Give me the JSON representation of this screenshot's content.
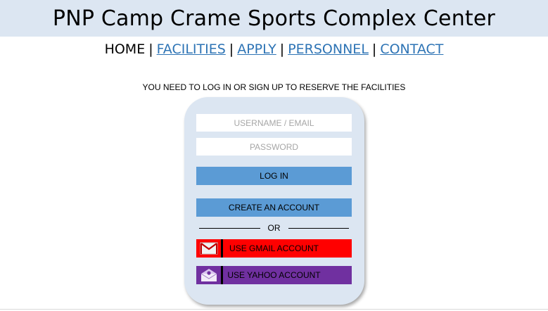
{
  "header": {
    "title": "PNP Camp Crame Sports Complex Center"
  },
  "nav": {
    "home": "HOME",
    "separator": "|",
    "facilities": "FACILITIES",
    "apply": "APPLY",
    "personnel": "PERSONNEL",
    "contact": "CONTACT"
  },
  "login": {
    "notice": "YOU NEED TO LOG IN OR SIGN UP TO RESERVE THE FACILITIES",
    "username_placeholder": "USERNAME / EMAIL",
    "username_value": "",
    "password_placeholder": "PASSWORD",
    "password_value": "",
    "login_label": "LOG IN",
    "create_account_label": "CREATE AN ACCOUNT",
    "or_label": "OR",
    "gmail_label": "USE GMAIL ACCOUNT",
    "gmail_icon": "gmail-envelope-icon",
    "yahoo_label": "USE YAHOO ACCOUNT",
    "yahoo_icon": "yahoo-envelope-icon"
  },
  "colors": {
    "header_band": "#dce6f2",
    "card": "#dce6f2",
    "button_blue": "#5b9bd5",
    "gmail_red": "#ff0000",
    "yahoo_purple": "#7030a0",
    "link": "#2e74b5"
  }
}
